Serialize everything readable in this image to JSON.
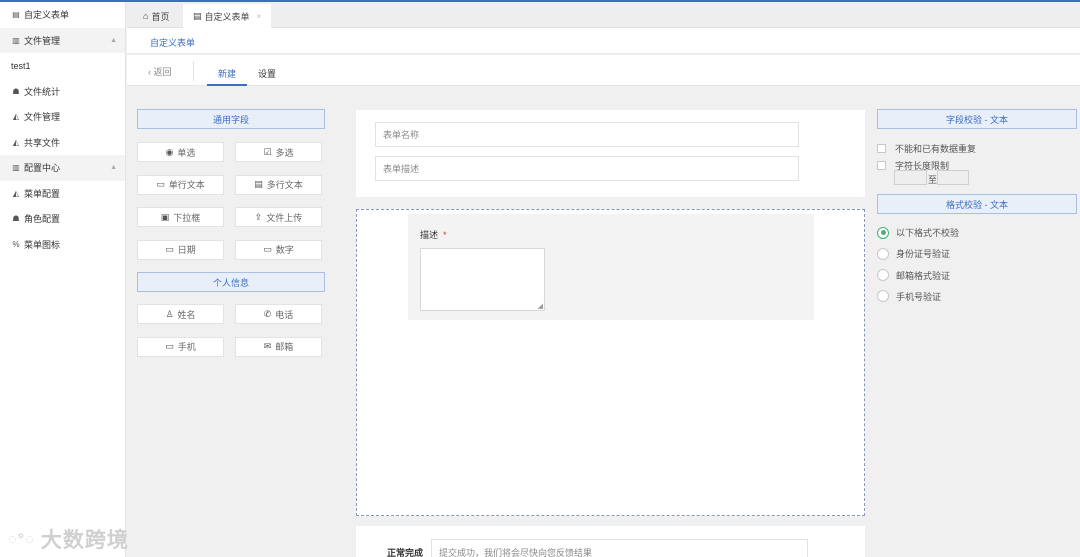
{
  "sidebar": {
    "items": [
      {
        "label": "自定义表单",
        "icon": "document-icon",
        "type": "item"
      },
      {
        "label": "文件管理",
        "icon": "bar-chart-icon",
        "type": "group"
      },
      {
        "label": "test1",
        "icon": "",
        "type": "item"
      },
      {
        "label": "文件统计",
        "icon": "users-icon",
        "type": "item"
      },
      {
        "label": "文件管理",
        "icon": "area-chart-icon",
        "type": "item"
      },
      {
        "label": "共享文件",
        "icon": "area-chart-icon",
        "type": "item"
      },
      {
        "label": "配置中心",
        "icon": "bar-chart-icon",
        "type": "group"
      },
      {
        "label": "菜单配置",
        "icon": "area-chart-icon",
        "type": "item"
      },
      {
        "label": "角色配置",
        "icon": "users-icon",
        "type": "item"
      },
      {
        "label": "菜单图标",
        "icon": "link-icon",
        "type": "item"
      }
    ]
  },
  "tabs": {
    "home": "首页",
    "active": "自定义表单",
    "close": "×"
  },
  "breadcrumb": "自定义表单",
  "subnav": {
    "back": "返回",
    "new": "新建",
    "settings": "设置"
  },
  "palette": {
    "common_title": "通用字段",
    "common_fields": [
      {
        "label": "单选",
        "glyph": "◉",
        "icon": "radio-icon"
      },
      {
        "label": "多选",
        "glyph": "☑",
        "icon": "checkbox-icon"
      },
      {
        "label": "单行文本",
        "glyph": "▭",
        "icon": "single-line-text-icon"
      },
      {
        "label": "多行文本",
        "glyph": "▤",
        "icon": "multi-line-text-icon"
      },
      {
        "label": "下拉框",
        "glyph": "▣",
        "icon": "dropdown-icon"
      },
      {
        "label": "文件上传",
        "glyph": "⇪",
        "icon": "upload-icon"
      },
      {
        "label": "日期",
        "glyph": "▭",
        "icon": "date-icon"
      },
      {
        "label": "数字",
        "glyph": "▭",
        "icon": "number-icon"
      }
    ],
    "personal_title": "个人信息",
    "personal_fields": [
      {
        "label": "姓名",
        "glyph": "♙",
        "icon": "person-icon"
      },
      {
        "label": "电话",
        "glyph": "✆",
        "icon": "phone-icon"
      },
      {
        "label": "手机",
        "glyph": "▭",
        "icon": "mobile-icon"
      },
      {
        "label": "邮箱",
        "glyph": "✉",
        "icon": "mail-icon"
      }
    ]
  },
  "form": {
    "name_placeholder": "表单名称",
    "desc_placeholder": "表单描述",
    "field_label": "描述",
    "required_mark": "*",
    "done_label": "正常完成",
    "done_text": "提交成功，我们将会尽快向您反馈结果"
  },
  "right": {
    "field_check_title": "字段校验 - 文本",
    "no_duplicate": "不能和已有数据重复",
    "length_limit": "字符长度限制",
    "length_to": "至",
    "format_check_title": "格式校验 - 文本",
    "format_options": [
      "以下格式不校验",
      "身份证号验证",
      "邮箱格式验证",
      "手机号验证"
    ],
    "format_selected": 0
  },
  "watermark": "大数跨境",
  "colors": {
    "accent": "#3b6ec2",
    "selected_radio": "#44b07a",
    "required": "#dd3333"
  }
}
